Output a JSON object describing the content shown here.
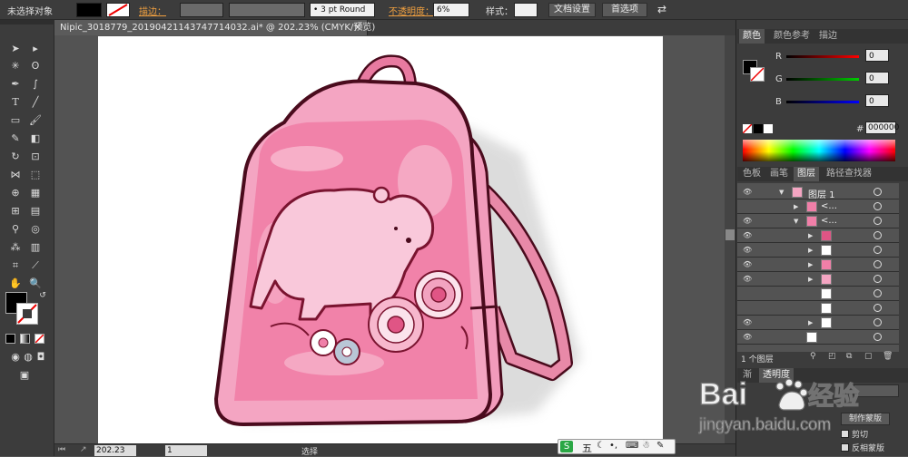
{
  "control_bar": {
    "selection_status": "未选择对象",
    "stroke_label": "描边：",
    "stroke_weight": "",
    "brush_profile": "• 3 pt Round",
    "opacity_label": "不透明度：",
    "opacity_value": "6%",
    "style_label": "样式：",
    "doc_setup_button": "文档设置",
    "preferences_button": "首选项"
  },
  "document_tab": {
    "title": "Nipic_3018779_20190421143747714032.ai* @ 202.23% (CMYK/预览)",
    "close": "×"
  },
  "color_panel": {
    "tabs": [
      "颜色",
      "颜色参考",
      "描边"
    ],
    "channels": [
      {
        "label": "R",
        "value": "0"
      },
      {
        "label": "G",
        "value": "0"
      },
      {
        "label": "B",
        "value": "0"
      }
    ],
    "hex_symbol": "#",
    "hex_value": "000000"
  },
  "layers_panel": {
    "tabs": [
      "色板",
      "画笔",
      "图层",
      "路径查找器"
    ],
    "active_tab": "图层",
    "top_layer_name": "图层 1",
    "sublayer_name": "<...",
    "footer_count": "1 个图层"
  },
  "bottom_panel": {
    "tabs": [
      "渐",
      "透明度"
    ],
    "make_mask_button": "制作蒙版",
    "clip_label": "剪切",
    "invert_label": "反相蒙版"
  },
  "status_bar": {
    "zoom": "202.23",
    "page": "1",
    "tool_name": "选择"
  },
  "ime_bar": {
    "mode": "五"
  },
  "watermark": {
    "brand": "Baidu经验",
    "url": "jingyan.baidu.com"
  },
  "colors": {
    "pink": "#f07fa8",
    "pink_light": "#f6a7c4",
    "outline": "#7a1430",
    "dark_ui": "#3c3c3c"
  }
}
